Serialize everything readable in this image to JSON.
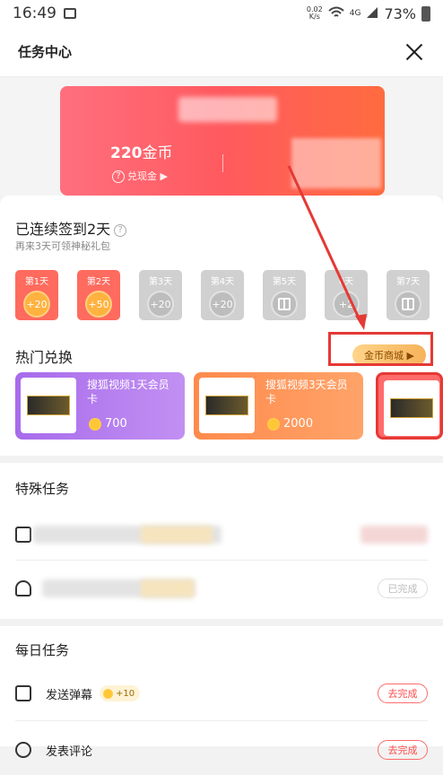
{
  "status": {
    "time": "16:49",
    "speed_top": "0.02",
    "speed_bottom": "K/s",
    "network": "4G",
    "battery": "73%"
  },
  "header": {
    "title": "任务中心"
  },
  "banner": {
    "coins_value": "220",
    "coins_unit": "金币",
    "cash_label": "兑现金 ▶",
    "cash_help": "?"
  },
  "signin": {
    "title": "已连续签到2天",
    "subtitle": "再来3天可领神秘礼包",
    "help": "?",
    "days": [
      {
        "label": "第1天",
        "reward": "+20"
      },
      {
        "label": "第2天",
        "reward": "+50"
      },
      {
        "label": "第3天",
        "reward": "+20"
      },
      {
        "label": "第4天",
        "reward": "+20"
      },
      {
        "label": "第5天",
        "reward": ""
      },
      {
        "label": "6天",
        "reward": "+2"
      },
      {
        "label": "第7天",
        "reward": ""
      }
    ]
  },
  "exchange": {
    "title": "热门兑换",
    "mall_button": "金币商城 ▶",
    "cards": [
      {
        "title": "搜狐视频1天会员卡",
        "price": "700"
      },
      {
        "title": "搜狐视频3天会员卡",
        "price": "2000"
      }
    ]
  },
  "special": {
    "title": "特殊任务",
    "done_button": "已完成"
  },
  "daily": {
    "title": "每日任务",
    "tasks": [
      {
        "label": "发送弹幕",
        "reward": "+10",
        "button": "去完成"
      },
      {
        "label": "发表评论",
        "reward": "",
        "button": "去完成"
      }
    ]
  },
  "colors": {
    "accent_red": "#ff4c4c",
    "annotation_red": "#e53935"
  }
}
